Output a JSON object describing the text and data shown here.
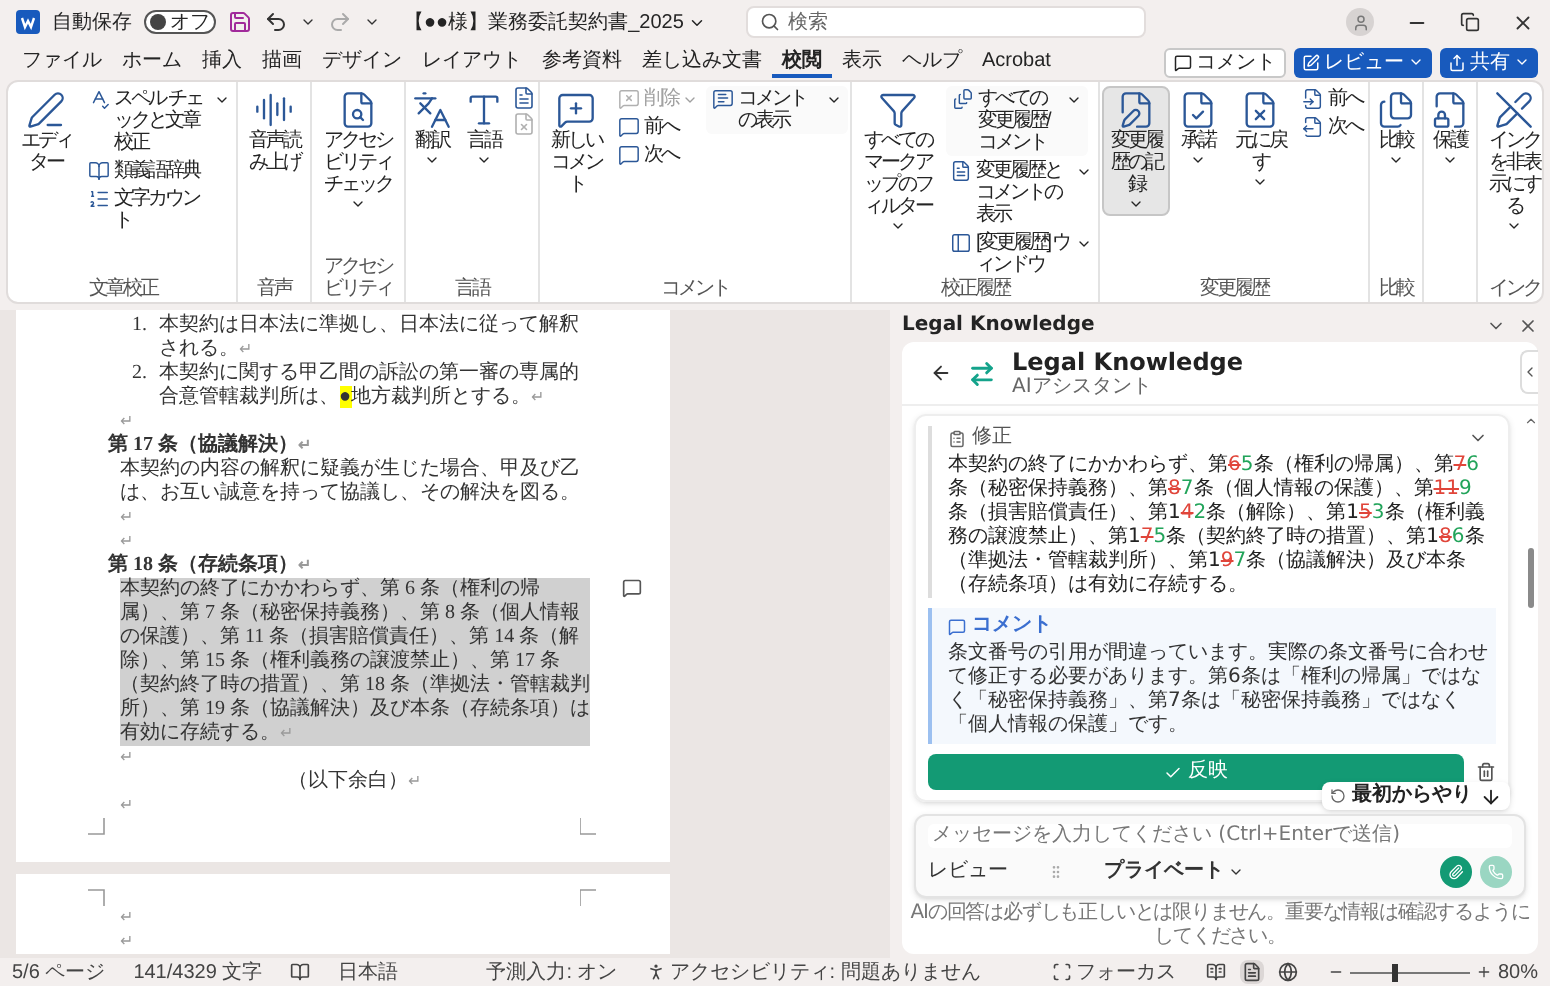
{
  "title_bar": {
    "autosave_label": "自動保存",
    "autosave": {
      "label": "オフ",
      "on": false
    },
    "document_title": "【●●様】業務委託契約書_2025",
    "search": {
      "placeholder": "検索"
    }
  },
  "menu_tabs": [
    {
      "label": "ファイル",
      "selected": false
    },
    {
      "label": "ホーム",
      "selected": false
    },
    {
      "label": "挿入",
      "selected": false
    },
    {
      "label": "描画",
      "selected": false
    },
    {
      "label": "デザイン",
      "selected": false
    },
    {
      "label": "レイアウト",
      "selected": false
    },
    {
      "label": "参考資料",
      "selected": false
    },
    {
      "label": "差し込み文書",
      "selected": false
    },
    {
      "label": "校閲",
      "selected": true
    },
    {
      "label": "表示",
      "selected": false
    },
    {
      "label": "ヘルプ",
      "selected": false
    },
    {
      "label": "Acrobat",
      "selected": false
    }
  ],
  "header_buttons": [
    {
      "label": "コメント",
      "kind": "outline"
    },
    {
      "label": "レビュー",
      "kind": "primary"
    },
    {
      "label": "共有",
      "kind": "primary"
    }
  ],
  "ribbon": {
    "groups": [
      {
        "label": "文章校正",
        "columns": [
          [
            {
              "label": "エディター",
              "kind": "large",
              "disabled": false,
              "pressed": false,
              "dropdown": false
            }
          ],
          [
            {
              "label": "スペル チェックと文章校正",
              "kind": "small",
              "disabled": false,
              "pressed": false,
              "dropdown": true
            },
            {
              "label": "類義語辞典",
              "kind": "small",
              "disabled": false,
              "pressed": false,
              "dropdown": false
            },
            {
              "label": "文字カウント",
              "kind": "small",
              "disabled": false,
              "pressed": false,
              "dropdown": false
            }
          ]
        ]
      },
      {
        "label": "音声",
        "columns": [
          [
            {
              "label": "音声読み上げ",
              "kind": "large",
              "disabled": false,
              "pressed": false,
              "dropdown": false
            }
          ]
        ]
      },
      {
        "label": "アクセシビリティ",
        "columns": [
          [
            {
              "label": "アクセシビリティチェック",
              "kind": "large",
              "disabled": false,
              "pressed": false,
              "dropdown": true
            }
          ]
        ]
      },
      {
        "label": "言語",
        "columns": [
          [
            {
              "label": "翻訳",
              "kind": "large",
              "disabled": false,
              "pressed": false,
              "dropdown": true
            }
          ],
          [
            {
              "label": "言語",
              "kind": "large",
              "disabled": false,
              "pressed": false,
              "dropdown": true
            }
          ],
          [
            {
              "kind": "icon",
              "disabled": false,
              "pressed": false
            },
            {
              "kind": "icon",
              "disabled": true,
              "pressed": false
            }
          ]
        ]
      },
      {
        "label": "コメント",
        "columns": [
          [
            {
              "label": "新しいコメント",
              "kind": "large",
              "disabled": false,
              "pressed": false,
              "dropdown": false
            }
          ],
          [
            {
              "label": "削除",
              "kind": "small",
              "disabled": true,
              "pressed": false,
              "dropdown": true
            },
            {
              "label": "前へ",
              "kind": "small",
              "disabled": false,
              "pressed": false,
              "dropdown": false
            },
            {
              "label": "次へ",
              "kind": "small",
              "disabled": false,
              "pressed": false,
              "dropdown": false
            }
          ],
          [
            {
              "label": "コメントの表示",
              "kind": "field",
              "disabled": false,
              "pressed": false,
              "dropdown": true
            }
          ]
        ]
      },
      {
        "label": "校正履歴",
        "columns": [
          [
            {
              "label": "すべてのマークアップのフィルター",
              "kind": "large",
              "disabled": false,
              "pressed": false,
              "dropdown": true
            }
          ],
          [
            {
              "label": "すべての変更履歴/コメント",
              "kind": "field",
              "disabled": false,
              "pressed": false,
              "dropdown": true
            },
            {
              "label": "変更履歴とコメントの表示",
              "kind": "small",
              "disabled": false,
              "pressed": false,
              "dropdown": true
            },
            {
              "label": "[変更履歴] ウィンドウ",
              "kind": "small",
              "disabled": false,
              "pressed": false,
              "dropdown": true
            }
          ]
        ]
      },
      {
        "label": "変更履歴",
        "columns": [
          [
            {
              "label": "変更履歴の記録",
              "kind": "large",
              "disabled": false,
              "pressed": true,
              "dropdown": true
            }
          ],
          [
            {
              "label": "承諾",
              "kind": "large",
              "disabled": false,
              "pressed": false,
              "dropdown": true
            }
          ],
          [
            {
              "label": "元に戻す",
              "kind": "large",
              "disabled": false,
              "pressed": false,
              "dropdown": true
            }
          ],
          [
            {
              "label": "前へ",
              "kind": "small",
              "disabled": false,
              "pressed": false,
              "dropdown": false
            },
            {
              "label": "次へ",
              "kind": "small",
              "disabled": false,
              "pressed": false,
              "dropdown": false
            }
          ]
        ]
      },
      {
        "label": "比較",
        "columns": [
          [
            {
              "label": "比較",
              "kind": "large",
              "disabled": false,
              "pressed": false,
              "dropdown": true
            }
          ]
        ]
      },
      {
        "columns": [
          [
            {
              "label": "保護",
              "kind": "large",
              "disabled": false,
              "pressed": false,
              "dropdown": true
            }
          ]
        ]
      },
      {
        "label": "インク",
        "columns": [
          [
            {
              "label": "インクを非表示にする",
              "kind": "large",
              "disabled": false,
              "pressed": false,
              "dropdown": true
            }
          ]
        ]
      }
    ]
  },
  "document": {
    "pages": [
      {
        "blocks": [
          {
            "kind": "list_item",
            "number": "1.",
            "parts": [
              {
                "text": "本契約は日本法に準拠し、日本法に従って解釈される。",
                "highlight": false
              }
            ],
            "mark": "↵"
          },
          {
            "kind": "list_item",
            "number": "2.",
            "parts": [
              {
                "text": "本契約に関する甲乙間の訴訟の第一審の専属的合意管轄裁判所は、",
                "highlight": false
              },
              {
                "text": "●",
                "highlight": true
              },
              {
                "text": "地方裁判所とする。",
                "highlight": false
              }
            ],
            "mark": "↵"
          },
          {
            "kind": "blank",
            "mark": "↵"
          },
          {
            "kind": "heading",
            "text": "第 17 条（協議解決）",
            "mark": "↵"
          },
          {
            "kind": "paragraph",
            "text": "本契約の内容の解釈に疑義が生じた場合、甲及び乙は、お互い誠意を持って協議し、その解決を図る。",
            "selected": false,
            "comment": false,
            "mark": "↵"
          },
          {
            "kind": "blank",
            "mark": "↵"
          },
          {
            "kind": "heading",
            "text": "第 18 条（存続条項）",
            "mark": "↵"
          },
          {
            "kind": "paragraph",
            "text": "本契約の終了にかかわらず、第 6 条（権利の帰属）、第 7 条（秘密保持義務）、第 8 条（個人情報の保護）、第 11 条（損害賠償責任）、第 14 条（解除）、第 15 条（権利義務の譲渡禁止）、第 17 条（契約終了時の措置）、第 18 条（準拠法・管轄裁判所）、第 19 条（協議解決）及び本条（存続条項）は有効に存続する。",
            "selected": true,
            "comment": true,
            "mark": "↵"
          },
          {
            "kind": "blank",
            "mark": "↵"
          },
          {
            "kind": "centered",
            "text": "（以下余白）",
            "mark": "↵"
          },
          {
            "kind": "blank",
            "mark": "↵"
          }
        ]
      },
      {
        "blocks": [
          {
            "kind": "blank",
            "mark": "↵"
          },
          {
            "kind": "blank",
            "mark": "↵"
          }
        ]
      }
    ]
  },
  "side_pane": {
    "title": "Legal Knowledge",
    "card_title": "Legal Knowledge",
    "card_subtitle": "AIアシスタント",
    "suggestion": {
      "label": "修正",
      "segments": [
        {
          "text": "本契約の終了にかかわらず、第",
          "kind": "plain"
        },
        {
          "text": "6",
          "kind": "deleted"
        },
        {
          "text": "5",
          "kind": "inserted"
        },
        {
          "text": "条（権利の帰属）、第",
          "kind": "plain"
        },
        {
          "text": "7",
          "kind": "deleted"
        },
        {
          "text": "6",
          "kind": "inserted"
        },
        {
          "text": "条（秘密保持義務）、第",
          "kind": "plain"
        },
        {
          "text": "8",
          "kind": "deleted"
        },
        {
          "text": "7",
          "kind": "inserted"
        },
        {
          "text": "条（個人情報の保護）、第",
          "kind": "plain"
        },
        {
          "text": "11",
          "kind": "deleted"
        },
        {
          "text": "9",
          "kind": "inserted"
        },
        {
          "text": "条（損害賠償責任）、第1",
          "kind": "plain"
        },
        {
          "text": "4",
          "kind": "deleted"
        },
        {
          "text": "2",
          "kind": "inserted"
        },
        {
          "text": "条（解除）、第1",
          "kind": "plain"
        },
        {
          "text": "5",
          "kind": "deleted"
        },
        {
          "text": "3",
          "kind": "inserted"
        },
        {
          "text": "条（権利義務の譲渡禁止）、第1",
          "kind": "plain"
        },
        {
          "text": "7",
          "kind": "deleted"
        },
        {
          "text": "5",
          "kind": "inserted"
        },
        {
          "text": "条（契約終了時の措置）、第1",
          "kind": "plain"
        },
        {
          "text": "8",
          "kind": "deleted"
        },
        {
          "text": "6",
          "kind": "inserted"
        },
        {
          "text": "条（準拠法・管轄裁判所）、第1",
          "kind": "plain"
        },
        {
          "text": "9",
          "kind": "deleted"
        },
        {
          "text": "7",
          "kind": "inserted"
        },
        {
          "text": "条（協議解決）及び本条（存続条項）は有効に存続する。",
          "kind": "plain"
        }
      ],
      "comment_label": "コメント",
      "comment": "条文番号の引用が間違っています。実際の条文番号に合わせて修正する必要があります。第6条は「権利の帰属」ではなく「秘密保持義務」、第7条は「秘密保持義務」ではなく「個人情報の保護」です。",
      "apply_button": "反映"
    },
    "restart_button": "最初からやり",
    "composer": {
      "placeholder": "メッセージを入力してください (Ctrl+Enterで送信)",
      "mode": "レビュー",
      "visibility": "プライベート"
    },
    "disclaimer": "AIの回答は必ずしも正しいとは限りません。重要な情報は確認するようにしてください。"
  },
  "status_bar": {
    "page": "5/6 ページ",
    "words": "141/4329 文字",
    "language": "日本語",
    "predictive": "予測入力: オン",
    "accessibility": "アクセシビリティ: 問題ありません",
    "focus": "フォーカス",
    "views": [
      {
        "selected": false
      },
      {
        "selected": true
      },
      {
        "selected": false
      }
    ],
    "zoom": {
      "level": 0.35,
      "label": "80%"
    }
  }
}
